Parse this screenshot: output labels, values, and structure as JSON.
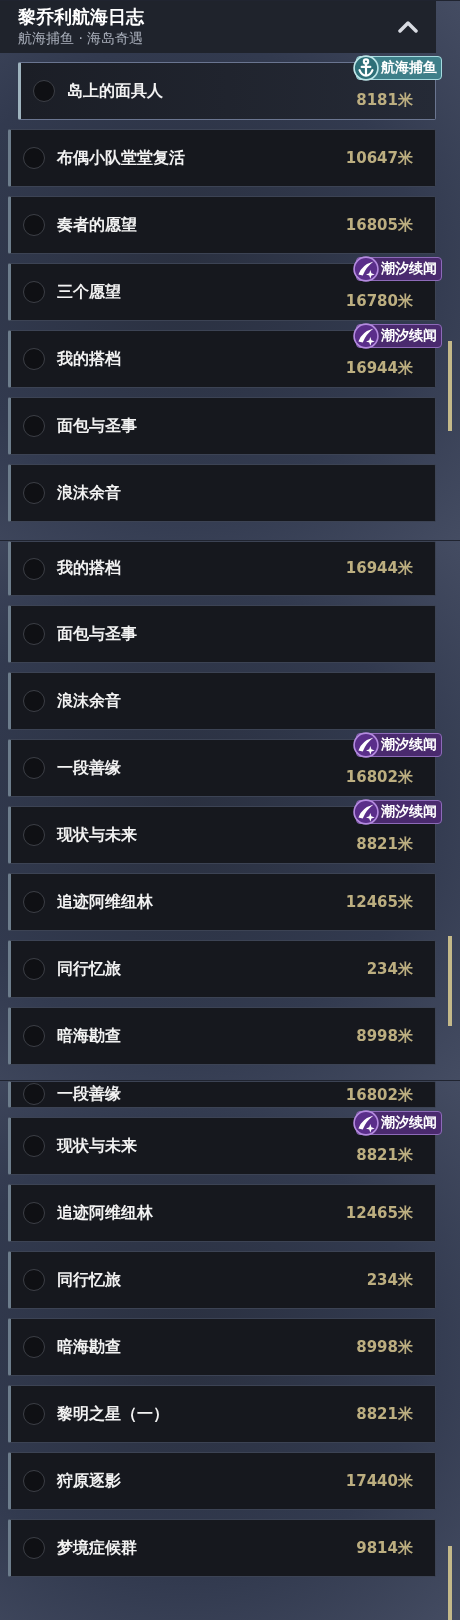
{
  "screens": [
    {
      "header": {
        "title": "黎乔利航海日志",
        "subtitle": "航海捕鱼 · 海岛奇遇",
        "expanded": true
      },
      "rows": [
        {
          "name": "岛上的面具人",
          "distance": "8181米",
          "highlighted": true,
          "badge": {
            "kind": "fishing",
            "label": "航海捕鱼"
          }
        },
        {
          "name": "布偶小队堂堂复活",
          "distance": "10647米",
          "highlighted": false
        },
        {
          "name": "奏者的愿望",
          "distance": "16805米",
          "highlighted": false
        },
        {
          "name": "三个愿望",
          "distance": "16780米",
          "highlighted": false,
          "badge": {
            "kind": "tide",
            "label": "潮汐续闻"
          }
        },
        {
          "name": "我的搭档",
          "distance": "16944米",
          "highlighted": false,
          "badge": {
            "kind": "tide",
            "label": "潮汐续闻"
          }
        },
        {
          "name": "面包与圣事",
          "highlighted": false
        },
        {
          "name": "浪沫余音",
          "highlighted": false
        }
      ]
    },
    {
      "rows": [
        {
          "name": "我的搭档",
          "distance": "16944米",
          "highlighted": false
        },
        {
          "name": "面包与圣事",
          "highlighted": false
        },
        {
          "name": "浪沫余音",
          "highlighted": false
        },
        {
          "name": "一段善缘",
          "distance": "16802米",
          "highlighted": false,
          "badge": {
            "kind": "tide",
            "label": "潮汐续闻"
          }
        },
        {
          "name": "现状与未来",
          "distance": "8821米",
          "highlighted": false,
          "badge": {
            "kind": "tide",
            "label": "潮汐续闻"
          }
        },
        {
          "name": "追迹阿维纽林",
          "distance": "12465米",
          "highlighted": false
        },
        {
          "name": "同行忆旅",
          "distance": "234米",
          "highlighted": false
        },
        {
          "name": "暗海勘查",
          "distance": "8998米",
          "highlighted": false
        }
      ]
    },
    {
      "rows": [
        {
          "name": "一段善缘",
          "distance": "16802米",
          "highlighted": false
        },
        {
          "name": "现状与未来",
          "distance": "8821米",
          "highlighted": false,
          "badge": {
            "kind": "tide",
            "label": "潮汐续闻"
          }
        },
        {
          "name": "追迹阿维纽林",
          "distance": "12465米",
          "highlighted": false
        },
        {
          "name": "同行忆旅",
          "distance": "234米",
          "highlighted": false
        },
        {
          "name": "暗海勘查",
          "distance": "8998米",
          "highlighted": false
        },
        {
          "name": "黎明之星（一）",
          "distance": "8821米",
          "highlighted": false
        },
        {
          "name": "狩原逐影",
          "distance": "17440米",
          "highlighted": false
        },
        {
          "name": "梦境症候群",
          "distance": "9814米",
          "highlighted": false
        }
      ]
    }
  ]
}
